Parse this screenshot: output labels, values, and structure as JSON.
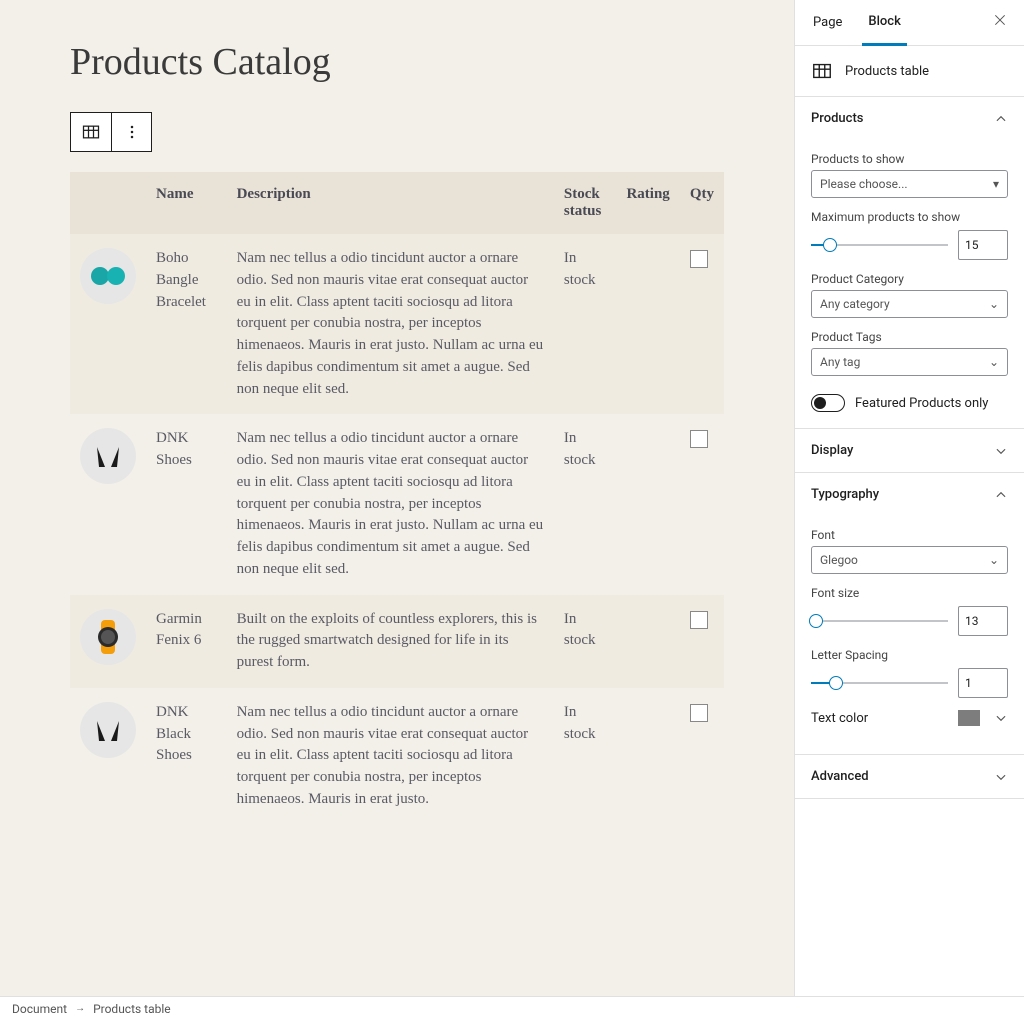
{
  "page": {
    "title": "Products Catalog"
  },
  "table": {
    "headers": {
      "image": "",
      "name": "Name",
      "description": "Description",
      "stock": "Stock status",
      "rating": "Rating",
      "qty": "Qty"
    },
    "rows": [
      {
        "name": "Boho Bangle Bracelet",
        "icon": "bracelet",
        "description": "Nam nec tellus a odio tincidunt auctor a ornare odio. Sed non mauris vitae erat consequat auctor eu in elit. Class aptent taciti sociosqu ad litora torquent per conubia nostra, per inceptos himenaeos. Mauris in erat justo. Nullam ac urna eu felis dapibus condimentum sit amet a augue. Sed non neque elit sed.",
        "stock": "In stock"
      },
      {
        "name": "DNK Shoes",
        "icon": "shoes",
        "description": "Nam nec tellus a odio tincidunt auctor a ornare odio. Sed non mauris vitae erat consequat auctor eu in elit. Class aptent taciti sociosqu ad litora torquent per conubia nostra, per inceptos himenaeos. Mauris in erat justo. Nullam ac urna eu felis dapibus condimentum sit amet a augue. Sed non neque elit sed.",
        "stock": "In stock"
      },
      {
        "name": "Garmin Fenix 6",
        "icon": "watch",
        "description": "Built on the exploits of countless explorers, this is the rugged smartwatch designed for life in its purest form.",
        "stock": "In stock"
      },
      {
        "name": "DNK Black Shoes",
        "icon": "shoes",
        "description": "Nam nec tellus a odio tincidunt auctor a ornare odio. Sed non mauris vitae erat consequat auctor eu in elit. Class aptent taciti sociosqu ad litora torquent per conubia nostra, per inceptos himenaeos. Mauris in erat justo.",
        "stock": "In stock"
      }
    ]
  },
  "tabs": {
    "page": "Page",
    "block": "Block"
  },
  "block_card": {
    "title": "Products table"
  },
  "panels": {
    "products": {
      "title": "Products",
      "products_to_show_label": "Products to show",
      "products_to_show_value": "Please choose...",
      "max_label": "Maximum products to show",
      "max_value": "15",
      "category_label": "Product Category",
      "category_value": "Any category",
      "tags_label": "Product Tags",
      "tags_value": "Any tag",
      "featured_label": "Featured Products only"
    },
    "display": {
      "title": "Display"
    },
    "typography": {
      "title": "Typography",
      "font_label": "Font",
      "font_value": "Glegoo",
      "size_label": "Font size",
      "size_value": "13",
      "spacing_label": "Letter Spacing",
      "spacing_value": "1",
      "text_color_label": "Text color"
    },
    "advanced": {
      "title": "Advanced"
    }
  },
  "breadcrumb": {
    "root": "Document",
    "leaf": "Products table"
  },
  "colors": {
    "accent": "#007cba",
    "text_color_swatch": "#7d7d7d"
  }
}
